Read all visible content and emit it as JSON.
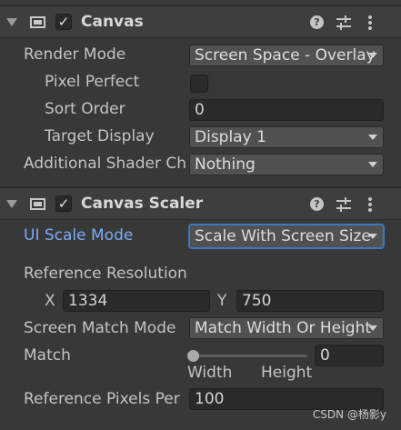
{
  "canvas": {
    "title": "Canvas",
    "enabled": true,
    "render_mode_label": "Render Mode",
    "render_mode_value": "Screen Space - Overlay",
    "pixel_perfect_label": "Pixel Perfect",
    "pixel_perfect_checked": false,
    "sort_order_label": "Sort Order",
    "sort_order_value": "0",
    "target_display_label": "Target Display",
    "target_display_value": "Display 1",
    "additional_shader_label": "Additional Shader Channels",
    "additional_shader_value": "Nothing"
  },
  "canvas_scaler": {
    "title": "Canvas Scaler",
    "enabled": true,
    "ui_scale_mode_label": "UI Scale Mode",
    "ui_scale_mode_value": "Scale With Screen Size",
    "reference_resolution_label": "Reference Resolution",
    "x_label": "X",
    "x_value": "1334",
    "y_label": "Y",
    "y_value": "750",
    "screen_match_mode_label": "Screen Match Mode",
    "screen_match_mode_value": "Match Width Or Height",
    "match_label": "Match",
    "match_value": "0",
    "match_slider_fraction": 0,
    "width_label": "Width",
    "height_label": "Height",
    "reference_pixels_label": "Reference Pixels Per Unit",
    "reference_pixels_value": "100"
  },
  "icons": {
    "component": "canvas-component-icon",
    "help": "help-icon",
    "presets": "presets-sliders-icon",
    "menu": "kebab-menu-icon"
  },
  "colors": {
    "background": "#383838",
    "header": "#3e3e3e",
    "accent_label": "#7cacf8",
    "focus_border": "#3a79bb"
  },
  "watermark": "CSDN @杨影y"
}
